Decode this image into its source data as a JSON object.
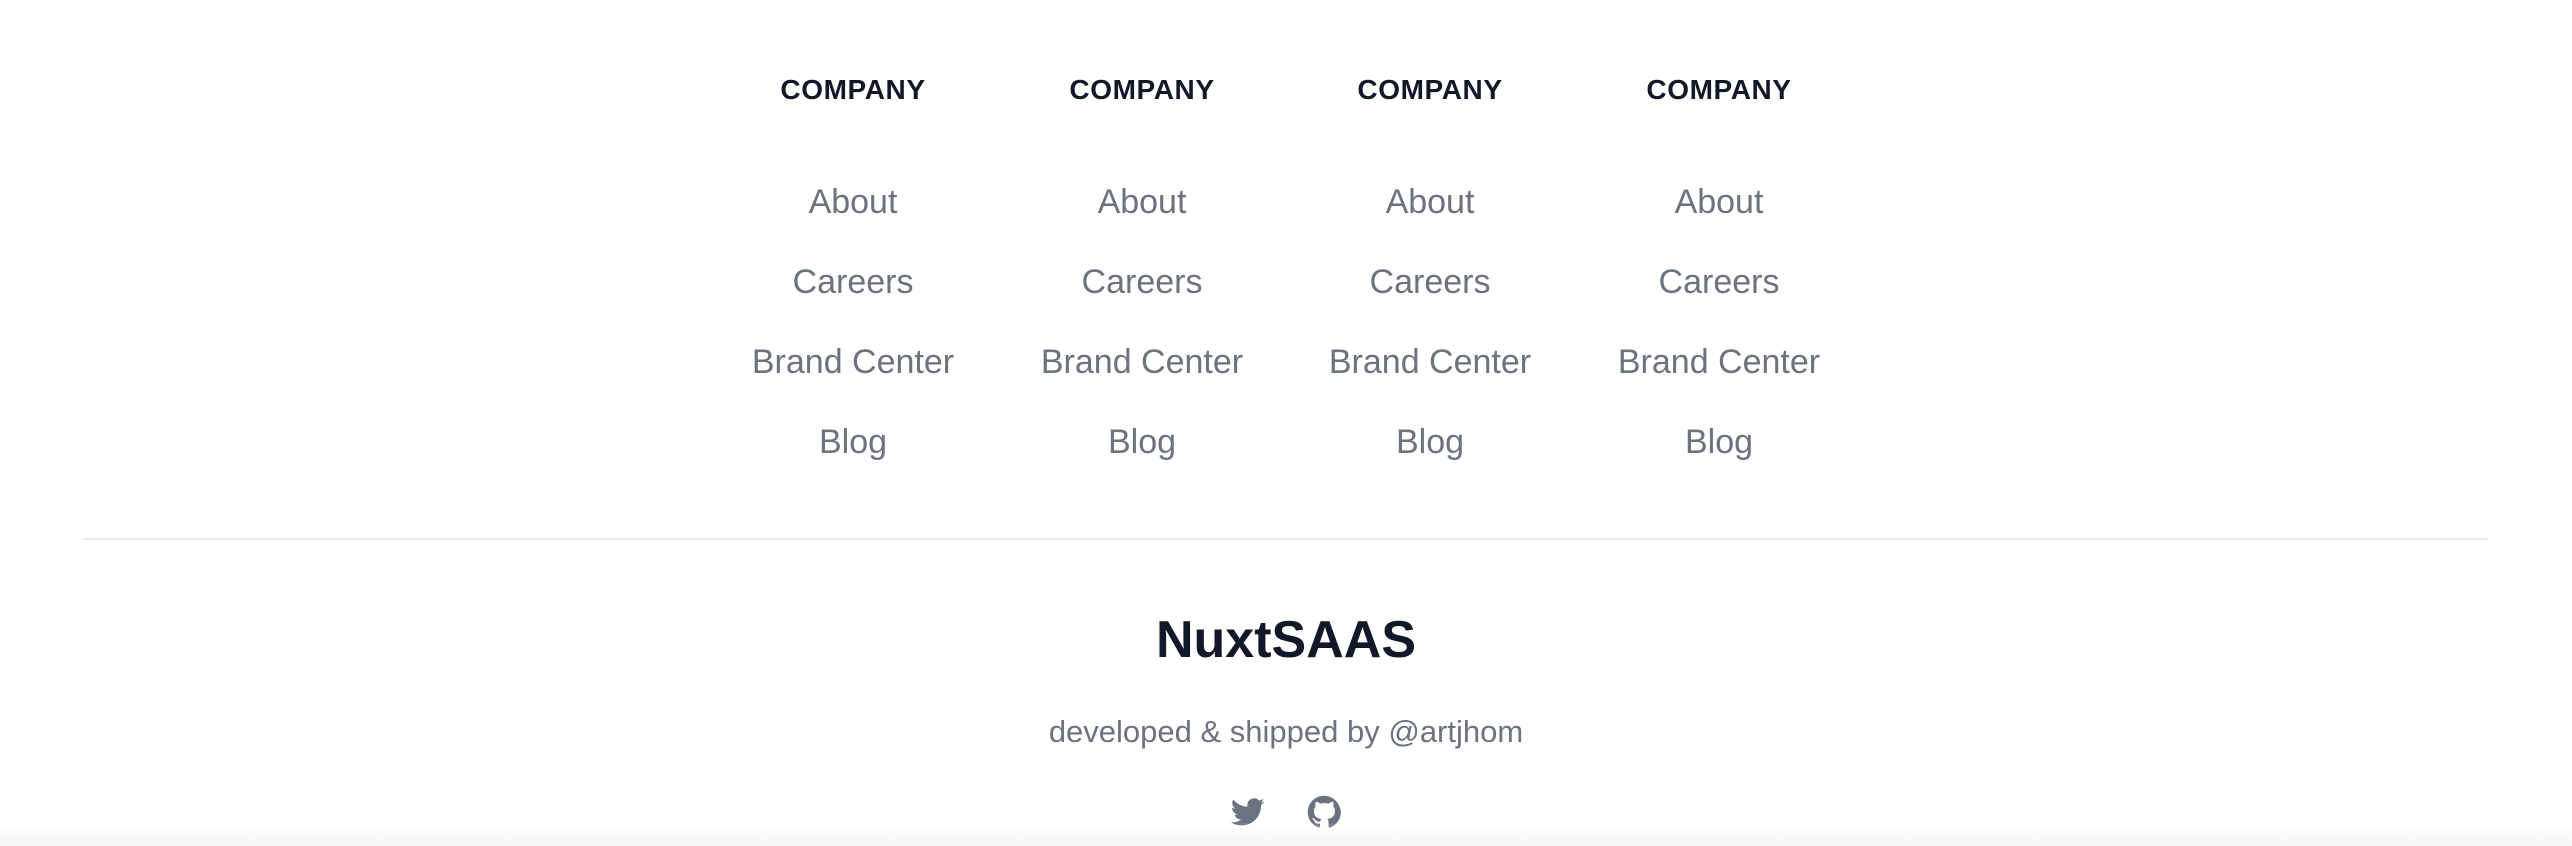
{
  "footer": {
    "columns": [
      {
        "heading": "COMPANY",
        "links": [
          "About",
          "Careers",
          "Brand Center",
          "Blog"
        ]
      },
      {
        "heading": "COMPANY",
        "links": [
          "About",
          "Careers",
          "Brand Center",
          "Blog"
        ]
      },
      {
        "heading": "COMPANY",
        "links": [
          "About",
          "Careers",
          "Brand Center",
          "Blog"
        ]
      },
      {
        "heading": "COMPANY",
        "links": [
          "About",
          "Careers",
          "Brand Center",
          "Blog"
        ]
      }
    ],
    "brand_name": "NuxtSAAS",
    "developer_credit": "developed & shipped by @artjhom",
    "social_icons": [
      "twitter-icon",
      "github-icon"
    ],
    "colors": {
      "heading": "#111827",
      "link": "#6b7280",
      "divider": "#e5e7eb",
      "background": "#ffffff"
    }
  }
}
